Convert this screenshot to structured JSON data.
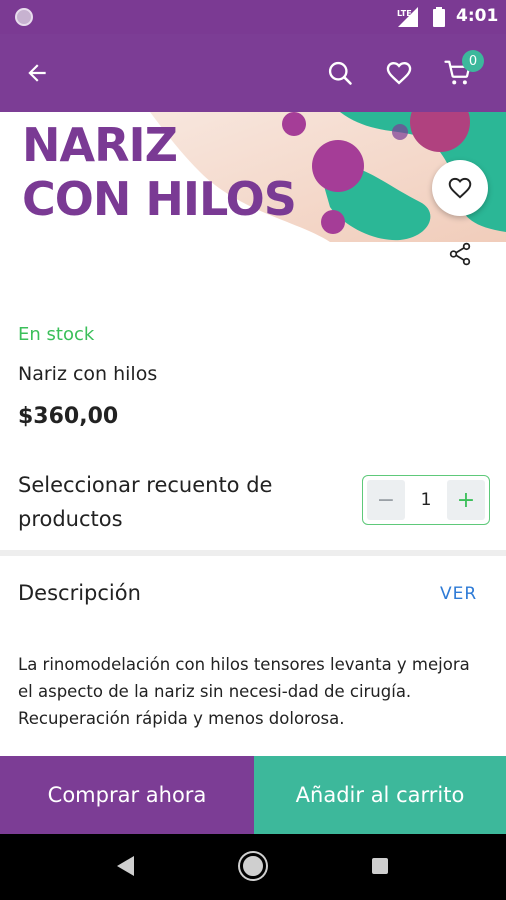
{
  "status_bar": {
    "time": "4:01",
    "network": "LTE",
    "icons": [
      "notification-dot-icon",
      "lte-signal-icon",
      "battery-icon"
    ]
  },
  "app_bar": {
    "icons": [
      "arrow-back-icon",
      "search-icon",
      "heart-outline-icon",
      "cart-icon"
    ],
    "cart_count": "0"
  },
  "hero": {
    "title_line1": "NARIZ",
    "title_line2": "CON HILOS",
    "colors": {
      "title": "#7a3a94",
      "accent_green": "#2bb796",
      "accent_purple": "#a53d97"
    }
  },
  "product": {
    "stock_status": "En stock",
    "name": "Nariz con hilos",
    "price": "$360,00"
  },
  "quantity": {
    "label": "Seleccionar recuento de productos",
    "minus": "−",
    "value": "1",
    "plus": "+"
  },
  "description": {
    "title": "Descripción",
    "link": "VER",
    "text": "La rinomodelación con hilos tensores levanta y mejora el aspecto de la nariz sin necesi-dad de cirugía. Recuperación rápida y menos dolorosa."
  },
  "actions": {
    "buy_now": "Comprar ahora",
    "add_to_cart": "Añadir al carrito"
  },
  "theme": {
    "primary": "#7c3d95",
    "secondary": "#3db89b",
    "stock_green": "#3bbf5a",
    "link_blue": "#2e7bd6"
  }
}
